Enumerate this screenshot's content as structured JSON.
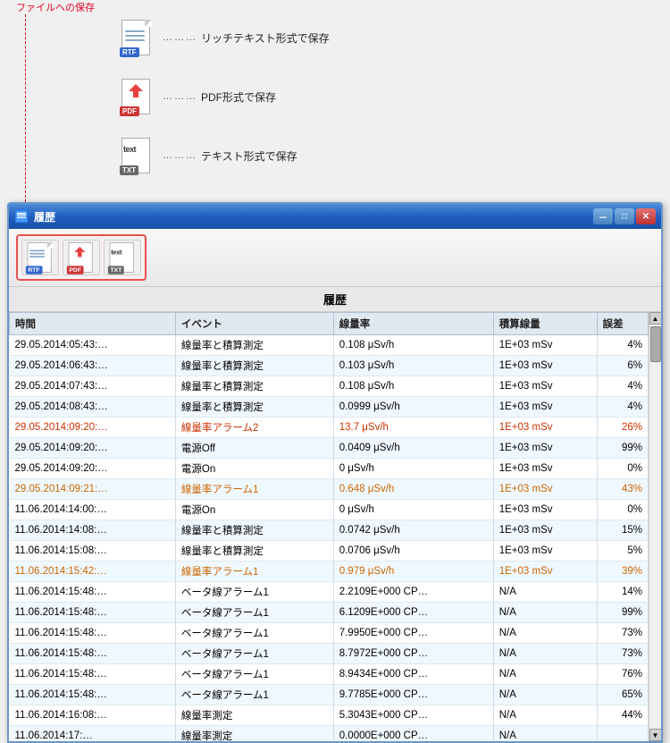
{
  "annotation": {
    "save_label": "ファイルへの保存",
    "items": [
      {
        "id": "rtf",
        "dots": "………",
        "text": "リッチテキスト形式で保存"
      },
      {
        "id": "pdf",
        "dots": "………",
        "text": "PDF形式で保存"
      },
      {
        "id": "text",
        "dots": "………",
        "text": "テキスト形式で保存"
      }
    ]
  },
  "window": {
    "title": "履歴",
    "minimize_label": "－",
    "maximize_label": "□",
    "close_label": "✕"
  },
  "toolbar": {
    "icons": [
      "rtf",
      "pdf",
      "text"
    ]
  },
  "table": {
    "title": "履歴",
    "columns": [
      "時間",
      "イベント",
      "線量率",
      "積算線量",
      "誤差"
    ],
    "rows": [
      {
        "time": "29.05.2014:05:43:…",
        "event": "線量率と積算測定",
        "dose_rate": "0.108 μSv/h",
        "accumulated": "1E+03 mSv",
        "error": "4%",
        "style": "normal"
      },
      {
        "time": "29.05.2014:06:43:…",
        "event": "線量率と積算測定",
        "dose_rate": "0.103 μSv/h",
        "accumulated": "1E+03 mSv",
        "error": "6%",
        "style": "normal"
      },
      {
        "time": "29.05.2014:07:43:…",
        "event": "線量率と積算測定",
        "dose_rate": "0.108 μSv/h",
        "accumulated": "1E+03 mSv",
        "error": "4%",
        "style": "normal"
      },
      {
        "time": "29.05.2014:08:43:…",
        "event": "線量率と積算測定",
        "dose_rate": "0.0999 μSv/h",
        "accumulated": "1E+03 mSv",
        "error": "4%",
        "style": "normal"
      },
      {
        "time": "29.05.2014:09:20:…",
        "event": "線量率アラーム2",
        "dose_rate": "13.7 μSv/h",
        "accumulated": "1E+03 mSv",
        "error": "26%",
        "style": "alarm"
      },
      {
        "time": "29.05.2014:09:20:…",
        "event": "電源Off",
        "dose_rate": "0.0409 μSv/h",
        "accumulated": "1E+03 mSv",
        "error": "99%",
        "style": "normal"
      },
      {
        "time": "29.05.2014:09:20:…",
        "event": "電源On",
        "dose_rate": "0 μSv/h",
        "accumulated": "1E+03 mSv",
        "error": "0%",
        "style": "normal"
      },
      {
        "time": "29.05.2014:09:21:…",
        "event": "線量率アラーム1",
        "dose_rate": "0.648 μSv/h",
        "accumulated": "1E+03 mSv",
        "error": "43%",
        "style": "orange"
      },
      {
        "time": "11.06.2014:14:00:…",
        "event": "電源On",
        "dose_rate": "0 μSv/h",
        "accumulated": "1E+03 mSv",
        "error": "0%",
        "style": "normal"
      },
      {
        "time": "11.06.2014:14:08:…",
        "event": "線量率と積算測定",
        "dose_rate": "0.0742 μSv/h",
        "accumulated": "1E+03 mSv",
        "error": "15%",
        "style": "normal"
      },
      {
        "time": "11.06.2014:15:08:…",
        "event": "線量率と積算測定",
        "dose_rate": "0.0706 μSv/h",
        "accumulated": "1E+03 mSv",
        "error": "5%",
        "style": "normal"
      },
      {
        "time": "11.06.2014:15:42:…",
        "event": "線量率アラーム1",
        "dose_rate": "0.979 μSv/h",
        "accumulated": "1E+03 mSv",
        "error": "39%",
        "style": "orange"
      },
      {
        "time": "11.06.2014:15:48:…",
        "event": "ベータ線アラーム1",
        "dose_rate": "2.2109E+000 CP…",
        "accumulated": "N/A",
        "error": "14%",
        "style": "normal"
      },
      {
        "time": "11.06.2014:15:48:…",
        "event": "ベータ線アラーム1",
        "dose_rate": "6.1209E+000 CP…",
        "accumulated": "N/A",
        "error": "99%",
        "style": "normal"
      },
      {
        "time": "11.06.2014:15:48:…",
        "event": "ベータ線アラーム1",
        "dose_rate": "7.9950E+000 CP…",
        "accumulated": "N/A",
        "error": "73%",
        "style": "normal"
      },
      {
        "time": "11.06.2014:15:48:…",
        "event": "ベータ線アラーム1",
        "dose_rate": "8.7972E+000 CP…",
        "accumulated": "N/A",
        "error": "73%",
        "style": "normal"
      },
      {
        "time": "11.06.2014:15:48:…",
        "event": "ベータ線アラーム1",
        "dose_rate": "8.9434E+000 CP…",
        "accumulated": "N/A",
        "error": "76%",
        "style": "normal"
      },
      {
        "time": "11.06.2014:15:48:…",
        "event": "ベータ線アラーム1",
        "dose_rate": "9.7785E+000 CP…",
        "accumulated": "N/A",
        "error": "65%",
        "style": "normal"
      },
      {
        "time": "11.06.2014:16:08:…",
        "event": "線量率測定",
        "dose_rate": "5.3043E+000 CP…",
        "accumulated": "N/A",
        "error": "44%",
        "style": "normal"
      },
      {
        "time": "11.06.2014:17:…",
        "event": "線量率測定",
        "dose_rate": "0.0000E+000 CP…",
        "accumulated": "N/A",
        "error": "",
        "style": "normal"
      }
    ]
  }
}
